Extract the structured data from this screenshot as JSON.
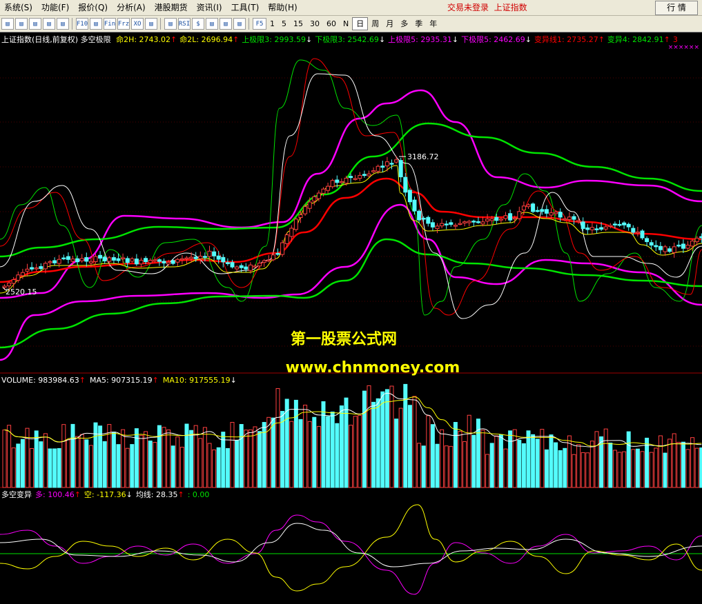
{
  "menu": {
    "items": [
      "系统(S)",
      "功能(F)",
      "报价(Q)",
      "分析(A)",
      "港股期货",
      "资讯(I)",
      "工具(T)",
      "帮助(H)"
    ],
    "status_text": "交易未登录",
    "symbol_label": "上证指数",
    "quote_button": "行 情"
  },
  "toolbar": {
    "icons": [
      "window-icon",
      "grid-icon",
      "line-icon",
      "candle-icon",
      "list-icon",
      "f10-icon",
      "f5-icon",
      "fin-icon",
      "frz-icon",
      "xo-icon",
      "window-search-icon",
      "chart-icon",
      "rsi-icon",
      "dollar-icon",
      "move-icon",
      "export-icon",
      "pencil-icon"
    ],
    "icon_text": [
      "",
      "",
      "",
      "",
      "",
      "F10",
      "",
      "Fin",
      "Frz",
      "XO",
      "",
      "",
      "RSI",
      "$",
      "",
      "",
      ""
    ],
    "period_f5": "F5",
    "periods": [
      "1",
      "5",
      "15",
      "30",
      "60",
      "N",
      "日",
      "周",
      "月",
      "多",
      "季",
      "年"
    ],
    "active_period": "日"
  },
  "colors": {
    "up": "#ff4040",
    "down": "#54fcfc",
    "white": "#ffffff",
    "yellow": "#ffff00",
    "green": "#00e400",
    "magenta": "#ff00ff",
    "red": "#ff0000",
    "axis": "#a00000",
    "watermark": "#ffff00"
  },
  "main_panel": {
    "title": "上证指数(日线,前复权) 多空极限",
    "legend": [
      {
        "text": "命2H: 2743.02",
        "arrow": "↑",
        "color": "#ffff00"
      },
      {
        "text": "命2L: 2696.94",
        "arrow": "↑",
        "color": "#ffff00"
      },
      {
        "text": "上极限3: 2993.59",
        "arrow": "↓",
        "color": "#00e400"
      },
      {
        "text": "下极限3: 2542.69",
        "arrow": "↓",
        "color": "#00e400"
      },
      {
        "text": "上极限5: 2935.31",
        "arrow": "↓",
        "color": "#ff00ff"
      },
      {
        "text": "下极限5: 2462.69",
        "arrow": "↓",
        "color": "#ff00ff"
      },
      {
        "text": "变异线1: 2735.27",
        "arrow": "↑",
        "color": "#ff0000"
      },
      {
        "text": "变异4: 2842.91",
        "arrow": "↑",
        "color": "#00e400"
      },
      {
        "text": "3",
        "arrow": "",
        "color": "#ff0000"
      }
    ],
    "high_label": "3186.72",
    "low_label": "2520.15",
    "marks": "××××××"
  },
  "volume_panel": {
    "legend": [
      {
        "text": "VOLUME: 983984.63",
        "arrow": "↑",
        "color": "#ffffff"
      },
      {
        "text": "MA5: 907315.19",
        "arrow": "↑",
        "color": "#ffffff"
      },
      {
        "text": "MA10: 917555.19",
        "arrow": "↓",
        "color": "#ffff00"
      }
    ]
  },
  "ls_panel": {
    "legend": [
      {
        "text": "多空变异",
        "arrow": "",
        "color": "#ffffff"
      },
      {
        "text": "多: 100.46",
        "arrow": "↑",
        "color": "#ff00ff"
      },
      {
        "text": "空: -117.36",
        "arrow": "↓",
        "color": "#ffff00"
      },
      {
        "text": "均线: 28.35",
        "arrow": "↑",
        "color": "#ffffff"
      },
      {
        "text": ": 0.00",
        "arrow": "",
        "color": "#00e400"
      }
    ]
  },
  "watermark": {
    "line1": "第一股票公式网",
    "line2": "www.chnmoney.com"
  }
}
